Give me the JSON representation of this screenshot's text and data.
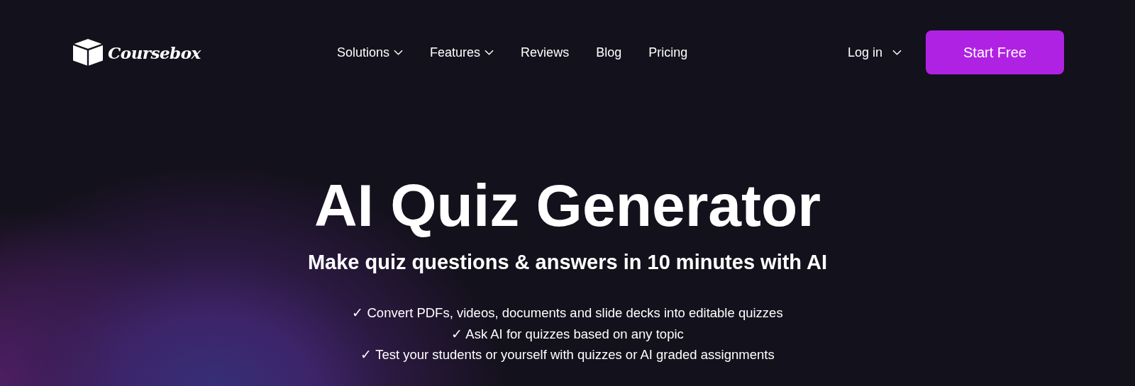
{
  "brand": {
    "name": "Coursebox"
  },
  "nav": [
    {
      "label": "Solutions",
      "dropdown": true
    },
    {
      "label": "Features",
      "dropdown": true
    },
    {
      "label": "Reviews",
      "dropdown": false
    },
    {
      "label": "Blog",
      "dropdown": false
    },
    {
      "label": "Pricing",
      "dropdown": false
    }
  ],
  "login": {
    "label": "Log in",
    "dropdown": true
  },
  "cta": {
    "label": "Start Free"
  },
  "hero": {
    "title": "AI Quiz Generator",
    "subtitle": "Make quiz questions & answers in 10 minutes with AI",
    "bullets": [
      "✓ Convert PDFs, videos, documents and slide decks into editable quizzes",
      "✓ Ask AI for quizzes based on any topic",
      "✓ Test your students or yourself with quizzes or AI graded assignments"
    ]
  }
}
